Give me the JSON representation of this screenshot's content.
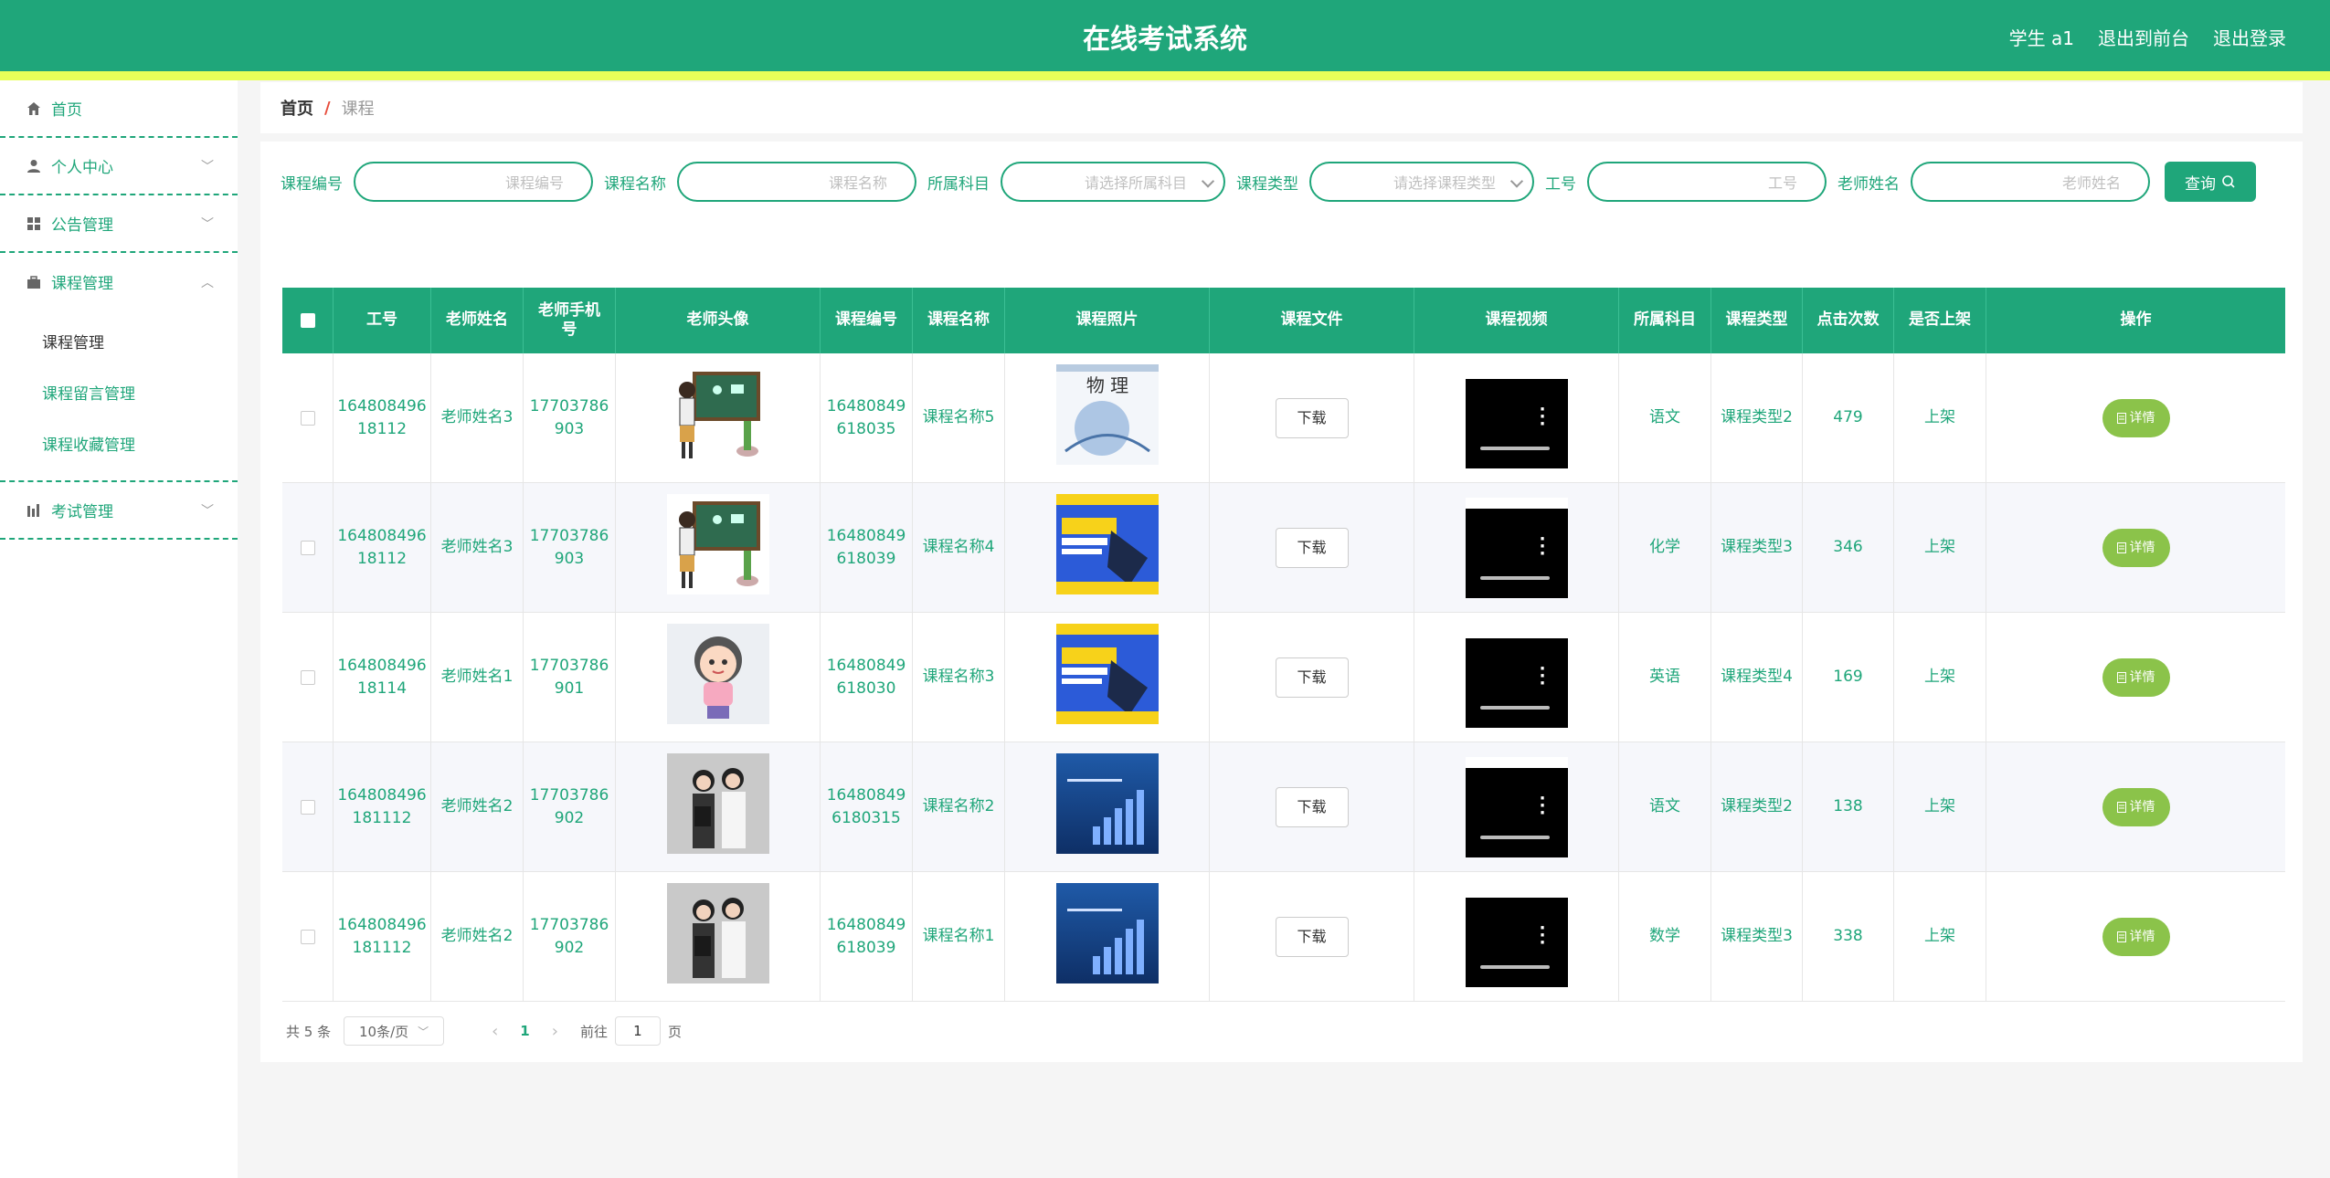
{
  "header": {
    "title": "在线考试系统",
    "user": "学生 a1",
    "to_front": "退出到前台",
    "logout": "退出登录"
  },
  "sidebar": {
    "items": [
      {
        "label": "首页",
        "icon": "home-icon"
      },
      {
        "label": "个人中心",
        "icon": "user-icon"
      },
      {
        "label": "公告管理",
        "icon": "grid-icon"
      },
      {
        "label": "课程管理",
        "icon": "briefcase-icon",
        "sub": [
          "课程管理",
          "课程留言管理",
          "课程收藏管理"
        ]
      },
      {
        "label": "考试管理",
        "icon": "chart-icon"
      }
    ]
  },
  "breadcrumb": {
    "home": "首页",
    "sep": "/",
    "current": "课程"
  },
  "search": {
    "fields": [
      {
        "label": "课程编号",
        "placeholder": "课程编号"
      },
      {
        "label": "课程名称",
        "placeholder": "课程名称"
      },
      {
        "label": "所属科目",
        "placeholder": "请选择所属科目"
      },
      {
        "label": "课程类型",
        "placeholder": "请选择课程类型"
      },
      {
        "label": "工号",
        "placeholder": "工号"
      },
      {
        "label": "老师姓名",
        "placeholder": "老师姓名"
      }
    ],
    "button": "查询"
  },
  "table": {
    "headers": [
      "工号",
      "老师姓名",
      "老师手机号",
      "老师头像",
      "课程编号",
      "课程名称",
      "课程照片",
      "课程文件",
      "课程视频",
      "所属科目",
      "课程类型",
      "点击次数",
      "是否上架",
      "操作"
    ],
    "download_label": "下载",
    "detail_label": "详情",
    "rows": [
      {
        "job_no": "164808496 18112",
        "teacher": "老师姓名3",
        "phone": "17703786 903",
        "avatar": "teacher-blackboard",
        "course_no": "16480849 618035",
        "course_name": "课程名称5",
        "photo": "physics-book",
        "subject": "语文",
        "type": "课程类型2",
        "clicks": "479",
        "status": "上架"
      },
      {
        "job_no": "164808496 18112",
        "teacher": "老师姓名3",
        "phone": "17703786 903",
        "avatar": "teacher-blackboard",
        "course_no": "16480849 618039",
        "course_name": "课程名称4",
        "photo": "math-book",
        "subject": "化学",
        "type": "课程类型3",
        "clicks": "346",
        "status": "上架"
      },
      {
        "job_no": "164808496 18114",
        "teacher": "老师姓名1",
        "phone": "17703786 901",
        "avatar": "cartoon-teacher",
        "course_no": "16480849 618030",
        "course_name": "课程名称3",
        "photo": "math-book",
        "subject": "英语",
        "type": "课程类型4",
        "clicks": "169",
        "status": "上架"
      },
      {
        "job_no": "164808496 181112",
        "teacher": "老师姓名2",
        "phone": "17703786 902",
        "avatar": "two-women",
        "course_no": "16480849 6180315",
        "course_name": "课程名称2",
        "photo": "blue-slides",
        "subject": "语文",
        "type": "课程类型2",
        "clicks": "138",
        "status": "上架"
      },
      {
        "job_no": "164808496 181112",
        "teacher": "老师姓名2",
        "phone": "17703786 902",
        "avatar": "two-women",
        "course_no": "16480849 618039",
        "course_name": "课程名称1",
        "photo": "blue-slides",
        "subject": "数学",
        "type": "课程类型3",
        "clicks": "338",
        "status": "上架"
      }
    ]
  },
  "pager": {
    "total": "共 5 条",
    "size": "10条/页",
    "current": "1",
    "goto_prefix": "前往",
    "goto_value": "1",
    "goto_suffix": "页"
  },
  "colors": {
    "primary": "#1fa67a",
    "accent_yellow": "#e8ff59",
    "detail_green": "#8bc34a"
  }
}
